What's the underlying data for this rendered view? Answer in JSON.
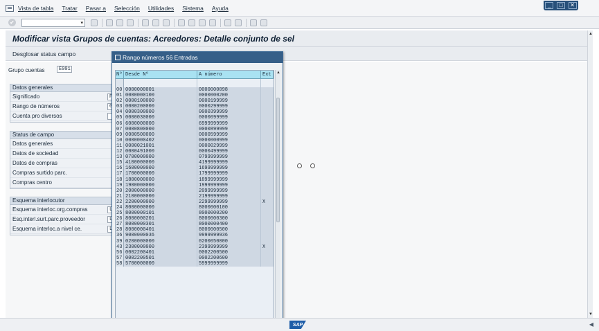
{
  "menubar": {
    "items": [
      "Vista de tabla",
      "Tratar",
      "Pasar a",
      "Selección",
      "Utilidades",
      "Sistema",
      "Ayuda"
    ]
  },
  "window_controls": [
    "_",
    "□",
    "✕"
  ],
  "page": {
    "title": "Modificar vista Grupos de cuentas: Acreedores: Detalle conjunto de sel",
    "subtool_label": "Desglosar status campo"
  },
  "grupo": {
    "label": "Grupo cuentas",
    "value": "E001"
  },
  "datos_generales": {
    "header": "Datos generales",
    "rows": [
      {
        "label": "Significado",
        "value": "Pr"
      },
      {
        "label": "Rango de números",
        "value": "0"
      },
      {
        "label": "Cuenta pro diversos",
        "value": ""
      }
    ]
  },
  "status_campo": {
    "header": "Status de campo",
    "rows": [
      "Datos generales",
      "Datos de sociedad",
      "Datos de compras",
      "Compras surtido parc.",
      "Compras centro"
    ]
  },
  "esquema": {
    "header": "Esquema interlocutor",
    "rows": [
      {
        "label": "Esquema interloc.org.compras",
        "value": "L"
      },
      {
        "label": "Esq.interl.surt.parc.proveedor",
        "value": "L"
      },
      {
        "label": "Esquema interloc.a nivel ce.",
        "value": "L"
      }
    ]
  },
  "dialog": {
    "title": "Rango números  56 Entradas",
    "columns": [
      "Nº",
      "Desde Nº",
      "A número",
      "Ext"
    ],
    "rows": [
      {
        "no": "00",
        "desde": "0000000001",
        "hasta": "0000000098",
        "ext": ""
      },
      {
        "no": "01",
        "desde": "0000000100",
        "hasta": "0000000200",
        "ext": ""
      },
      {
        "no": "02",
        "desde": "0000100000",
        "hasta": "0000199999",
        "ext": ""
      },
      {
        "no": "03",
        "desde": "0000200000",
        "hasta": "0000299999",
        "ext": ""
      },
      {
        "no": "04",
        "desde": "0000300000",
        "hasta": "0000399999",
        "ext": ""
      },
      {
        "no": "05",
        "desde": "0000030000",
        "hasta": "0000099999",
        "ext": ""
      },
      {
        "no": "06",
        "desde": "6000000000",
        "hasta": "6999999999",
        "ext": ""
      },
      {
        "no": "07",
        "desde": "0000800000",
        "hasta": "0000899999",
        "ext": ""
      },
      {
        "no": "09",
        "desde": "0000500000",
        "hasta": "0000599999",
        "ext": ""
      },
      {
        "no": "10",
        "desde": "0000000402",
        "hasta": "0000000999",
        "ext": ""
      },
      {
        "no": "11",
        "desde": "0000021001",
        "hasta": "0000029999",
        "ext": ""
      },
      {
        "no": "12",
        "desde": "0000491000",
        "hasta": "0000499999",
        "ext": ""
      },
      {
        "no": "13",
        "desde": "0700000000",
        "hasta": "0799999999",
        "ext": ""
      },
      {
        "no": "15",
        "desde": "4100000000",
        "hasta": "4199999999",
        "ext": ""
      },
      {
        "no": "16",
        "desde": "1600000000",
        "hasta": "1699999999",
        "ext": ""
      },
      {
        "no": "17",
        "desde": "1700000000",
        "hasta": "1799999999",
        "ext": ""
      },
      {
        "no": "18",
        "desde": "1800000000",
        "hasta": "1899999999",
        "ext": ""
      },
      {
        "no": "19",
        "desde": "1900000000",
        "hasta": "1999999999",
        "ext": ""
      },
      {
        "no": "20",
        "desde": "2000000000",
        "hasta": "2099999999",
        "ext": ""
      },
      {
        "no": "21",
        "desde": "2100000000",
        "hasta": "2199999999",
        "ext": ""
      },
      {
        "no": "22",
        "desde": "2200000000",
        "hasta": "2299999999",
        "ext": "X"
      },
      {
        "no": "24",
        "desde": "8000000000",
        "hasta": "8000000100",
        "ext": ""
      },
      {
        "no": "25",
        "desde": "8000000101",
        "hasta": "8000000200",
        "ext": ""
      },
      {
        "no": "26",
        "desde": "8000000201",
        "hasta": "8000000300",
        "ext": ""
      },
      {
        "no": "27",
        "desde": "8000000301",
        "hasta": "8000000400",
        "ext": ""
      },
      {
        "no": "28",
        "desde": "8000000401",
        "hasta": "8000000500",
        "ext": ""
      },
      {
        "no": "36",
        "desde": "9000000036",
        "hasta": "9999999936",
        "ext": ""
      },
      {
        "no": "39",
        "desde": "0200000000",
        "hasta": "0200050000",
        "ext": ""
      },
      {
        "no": "43",
        "desde": "2300000000",
        "hasta": "2399999999",
        "ext": "X"
      },
      {
        "no": "56",
        "desde": "0002200401",
        "hasta": "0002200500",
        "ext": ""
      },
      {
        "no": "57",
        "desde": "0002200501",
        "hasta": "0002200600",
        "ext": ""
      },
      {
        "no": "58",
        "desde": "5700000000",
        "hasta": "5999999999",
        "ext": ""
      }
    ],
    "footer_buttons": [
      "✔",
      "?",
      "★",
      "▤",
      "✖"
    ]
  },
  "status_bar": {
    "sap_logo": "SAP"
  }
}
